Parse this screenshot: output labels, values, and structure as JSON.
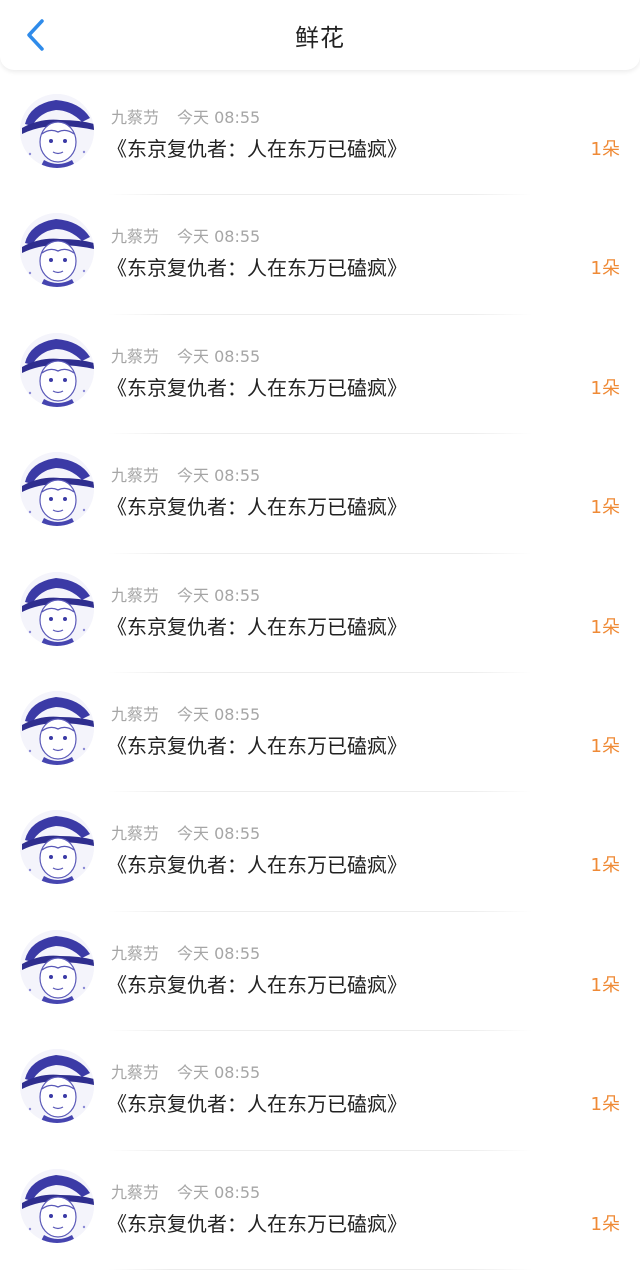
{
  "header": {
    "title": "鲜花",
    "back_icon": "chevron-left-icon",
    "accent_color": "#2f8bea"
  },
  "colors": {
    "count": "#ef8a36",
    "meta": "#a6a6a6",
    "text": "#222222"
  },
  "items": [
    {
      "user": "九蔡芀",
      "time": "今天 08:55",
      "book": "《东京复仇者：人在东万已磕疯》",
      "count": "1朵"
    },
    {
      "user": "九蔡芀",
      "time": "今天 08:55",
      "book": "《东京复仇者：人在东万已磕疯》",
      "count": "1朵"
    },
    {
      "user": "九蔡芀",
      "time": "今天 08:55",
      "book": "《东京复仇者：人在东万已磕疯》",
      "count": "1朵"
    },
    {
      "user": "九蔡芀",
      "time": "今天 08:55",
      "book": "《东京复仇者：人在东万已磕疯》",
      "count": "1朵"
    },
    {
      "user": "九蔡芀",
      "time": "今天 08:55",
      "book": "《东京复仇者：人在东万已磕疯》",
      "count": "1朵"
    },
    {
      "user": "九蔡芀",
      "time": "今天 08:55",
      "book": "《东京复仇者：人在东万已磕疯》",
      "count": "1朵"
    },
    {
      "user": "九蔡芀",
      "time": "今天 08:55",
      "book": "《东京复仇者：人在东万已磕疯》",
      "count": "1朵"
    },
    {
      "user": "九蔡芀",
      "time": "今天 08:55",
      "book": "《东京复仇者：人在东万已磕疯》",
      "count": "1朵"
    },
    {
      "user": "九蔡芀",
      "time": "今天 08:55",
      "book": "《东京复仇者：人在东万已磕疯》",
      "count": "1朵"
    },
    {
      "user": "九蔡芀",
      "time": "今天 08:55",
      "book": "《东京复仇者：人在东万已磕疯》",
      "count": "1朵"
    }
  ]
}
